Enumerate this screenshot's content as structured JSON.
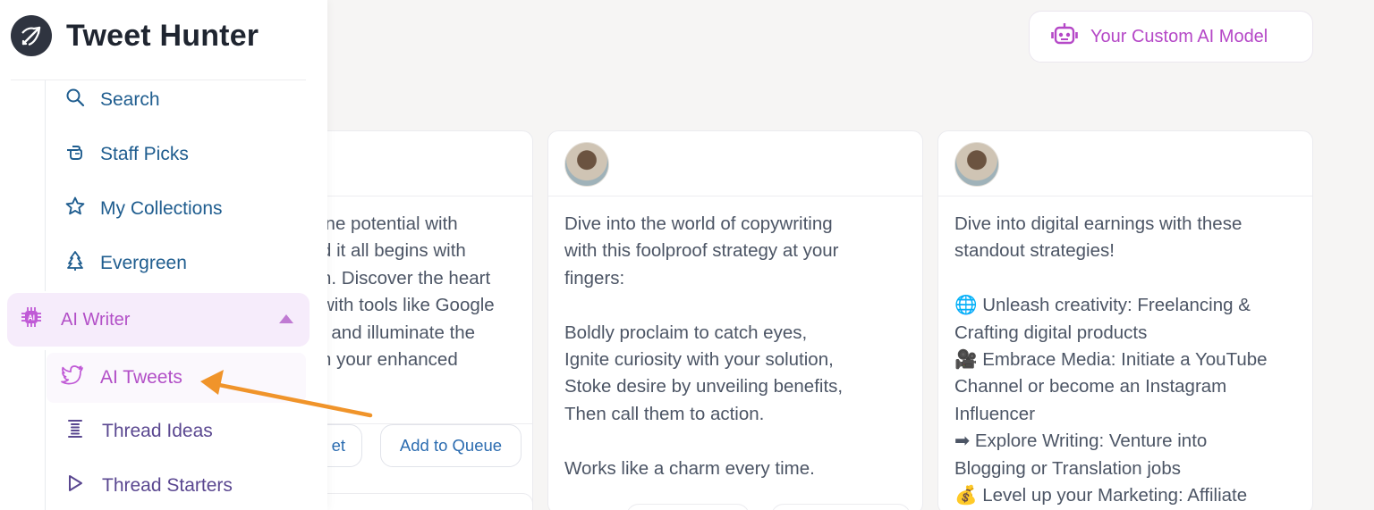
{
  "brand": {
    "name": "Tweet Hunter"
  },
  "topbar": {
    "custom_ai_label": "Your Custom AI Model"
  },
  "sidebar": {
    "items": [
      {
        "label": "Search",
        "icon": "search-icon"
      },
      {
        "label": "Staff Picks",
        "icon": "pointing-hand-icon"
      },
      {
        "label": "My Collections",
        "icon": "star-icon"
      },
      {
        "label": "Evergreen",
        "icon": "tree-icon"
      }
    ],
    "ai_writer": {
      "label": "AI Writer",
      "icon": "chip-icon",
      "expanded": true
    },
    "sub_items": [
      {
        "label": "AI Tweets",
        "icon": "twitter-bird-icon",
        "active": true
      },
      {
        "label": "Thread Ideas",
        "icon": "thread-list-icon"
      },
      {
        "label": "Thread Starters",
        "icon": "play-outline-icon"
      }
    ]
  },
  "cards": [
    {
      "text": "ine potential with\nd it all begins with\nh. Discover the heart\nwith tools like Google\n, and illuminate the\nn your enhanced",
      "actions": [
        "et",
        "Add to Queue"
      ]
    },
    {
      "text": "Dive into the world of copywriting\nwith this foolproof strategy at your\nfingers:\n\nBoldly proclaim to catch eyes,\nIgnite curiosity with your solution,\nStoke desire by unveiling benefits,\nThen call them to action.\n\nWorks like a charm every time."
    },
    {
      "text": "Dive into digital earnings with these\nstandout strategies!\n\n🌐 Unleash creativity: Freelancing &\nCrafting digital products\n🎥 Embrace Media: Initiate a YouTube\nChannel or become an Instagram\nInfluencer\n➡ Explore Writing: Venture into\nBlogging or Translation jobs\n💰 Level up your Marketing: Affiliate"
    }
  ],
  "colors": {
    "accent_purple": "#b24fc7",
    "nav_blue": "#1f5d8f",
    "annotation_arrow": "#f0942a"
  }
}
